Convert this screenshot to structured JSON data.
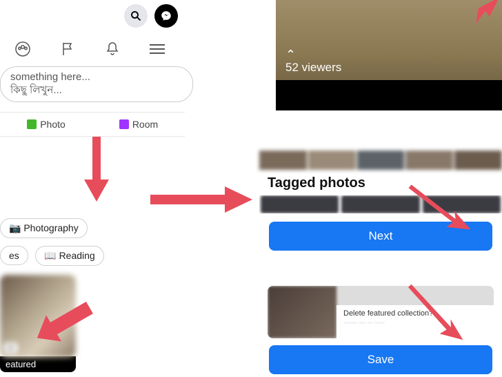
{
  "colors": {
    "fb_blue": "#1877f2",
    "arrow_red": "#e74c5b"
  },
  "left": {
    "post_placeholder_en": "something here...",
    "post_placeholder_bn": "কিছু লিখুন...",
    "photo_label": "Photo",
    "room_label": "Room",
    "chips": {
      "photography": "📷 Photography",
      "es": "es",
      "reading": "📖 Reading"
    },
    "featured": {
      "badge": "8",
      "label": "eatured"
    }
  },
  "story": {
    "viewers_text": "52 viewers"
  },
  "tagged": {
    "heading": "Tagged photos",
    "next_label": "Next"
  },
  "save": {
    "dialog_title": "Delete featured collection?",
    "save_label": "Save"
  }
}
